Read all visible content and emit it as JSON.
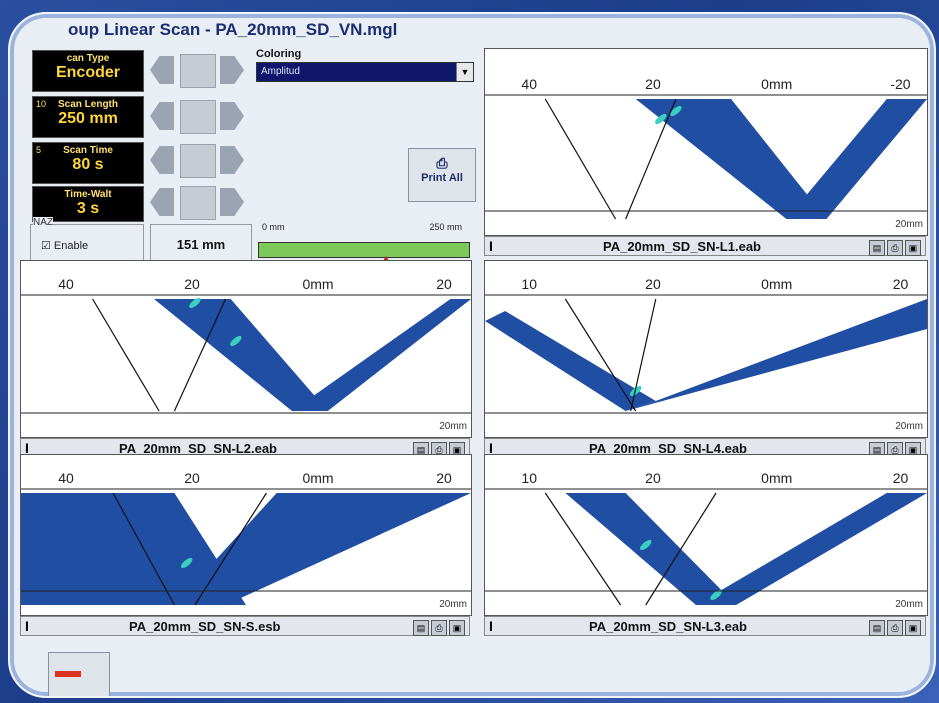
{
  "window": {
    "title": "oup Linear Scan - PA_20mm_SD_VN.mgl"
  },
  "controls": [
    {
      "index": "",
      "caption": "can Type",
      "value": "Encoder"
    },
    {
      "index": "10",
      "caption": "Scan Length",
      "value": "250 mm"
    },
    {
      "index": "5",
      "caption": "Scan Time",
      "value": "80 s"
    },
    {
      "index": "",
      "caption": "Time-Walt",
      "value": "3 s"
    }
  ],
  "coloring": {
    "label": "Coloring",
    "value": "Amplitud"
  },
  "print_all": "Print All",
  "naz": {
    "label": "NAZ",
    "checkbox_label": "Enable"
  },
  "scan_position": "151 mm",
  "progress": {
    "left_label": "0 mm",
    "right_label": "250 mm",
    "fraction": 0.6
  },
  "panels": [
    {
      "id": "L1",
      "filename": "PA_20mm_SD_SN-L1.eab",
      "ticks": [
        "40",
        "20",
        "0mm",
        "-20"
      ],
      "depth": "20mm",
      "cursor": "I"
    },
    {
      "id": "L2",
      "filename": "PA_20mm_SD_SN-L2.eab",
      "ticks": [
        "40",
        "20",
        "0mm",
        "20"
      ],
      "depth": "20mm",
      "cursor": "I"
    },
    {
      "id": "L4",
      "filename": "PA_20mm_SD_SN-L4.eab",
      "ticks": [
        "10",
        "20",
        "0mm",
        "20"
      ],
      "depth": "20mm",
      "cursor": "I"
    },
    {
      "id": "S",
      "filename": "PA_20mm_SD_SN-S.esb",
      "ticks": [
        "40",
        "20",
        "0mm",
        "20"
      ],
      "depth": "20mm",
      "cursor": "I"
    },
    {
      "id": "L3",
      "filename": "PA_20mm_SD_SN-L3.eab",
      "ticks": [
        "10",
        "20",
        "0mm",
        "20"
      ],
      "depth": "20mm",
      "cursor": "I"
    }
  ],
  "colors": {
    "beam": "#1f4ea3",
    "beam_dark": "#163d8a",
    "indication": "#39d0c0",
    "scan_title": "#1b2e72",
    "progress_fill": "#7cc95a",
    "select_bg": "#10166a"
  }
}
